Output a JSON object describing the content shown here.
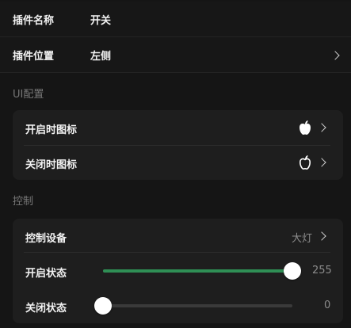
{
  "plugin": {
    "name_label": "插件名称",
    "name_value": "开关",
    "position_label": "插件位置",
    "position_value": "左侧"
  },
  "ui_config": {
    "section_title": "UI配置",
    "on_icon_label": "开启时图标",
    "on_icon": "apple-filled-icon",
    "off_icon_label": "关闭时图标",
    "off_icon": "apple-outline-icon"
  },
  "control": {
    "section_title": "控制",
    "device_label": "控制设备",
    "device_value": "大灯",
    "on_state_label": "开启状态",
    "on_state_value": 255,
    "off_state_label": "关闭状态",
    "off_state_value": 0,
    "slider_max": 255,
    "accent_color": "#2f8f55"
  }
}
